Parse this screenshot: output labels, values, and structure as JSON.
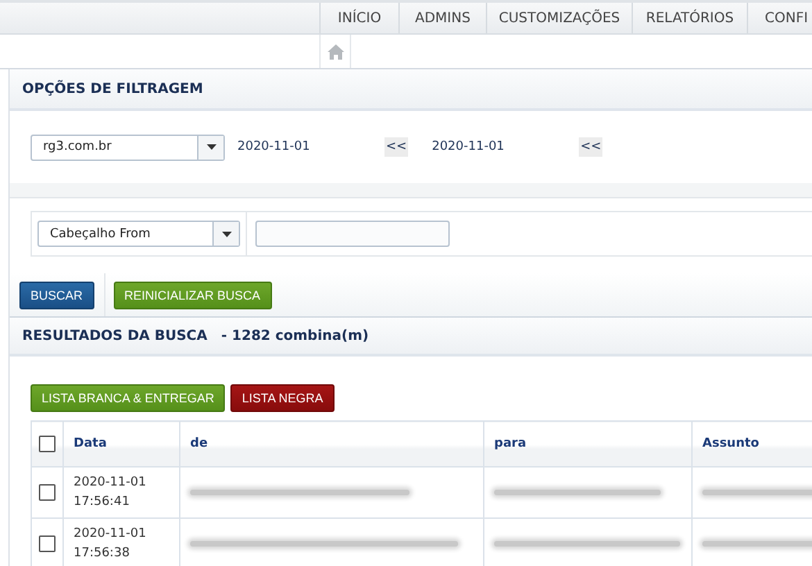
{
  "nav": {
    "tabs": [
      {
        "label": "INÍCIO",
        "selected": false
      },
      {
        "label": "ADMINS",
        "selected": false
      },
      {
        "label": "CUSTOMIZAÇÕES",
        "selected": false
      },
      {
        "label": "RELATÓRIOS",
        "selected": false
      },
      {
        "label": "CONFI",
        "selected": false
      }
    ]
  },
  "filter": {
    "title": "OPÇÕES DE FILTRAGEM",
    "domain": "rg3.com.br",
    "date_from": "2020-11-01",
    "date_from_button": "<<",
    "date_to": "2020-11-01",
    "date_to_button": "<<",
    "field": "Cabeçalho From"
  },
  "actions": [
    "BUSCAR",
    "REINICIALIZAR BUSCA"
  ],
  "results": {
    "title": "RESULTADOS DA BUSCA",
    "count": "- 1282 combina(m)",
    "buttons": [
      {
        "label": "LISTA BRANCA & ENTREGAR",
        "kind": "whitelist"
      },
      {
        "label": "LISTA NEGRA",
        "kind": "blacklist"
      }
    ],
    "all_checked": false,
    "columns": [
      "Data",
      "de",
      "para",
      "Assunto"
    ],
    "rows": [
      {
        "checked": false,
        "date": "2020-11-01",
        "time": "17:56:41",
        "cells": [
          {
            "kind": "blurred"
          },
          {
            "kind": "blurred"
          },
          {
            "kind": "blurred"
          }
        ]
      },
      {
        "checked": false,
        "date": "2020-11-01",
        "time": "17:56:38",
        "cells": [
          {
            "kind": "blurred"
          },
          {
            "kind": "blurred"
          },
          {
            "kind": "blurred"
          }
        ]
      }
    ]
  }
}
